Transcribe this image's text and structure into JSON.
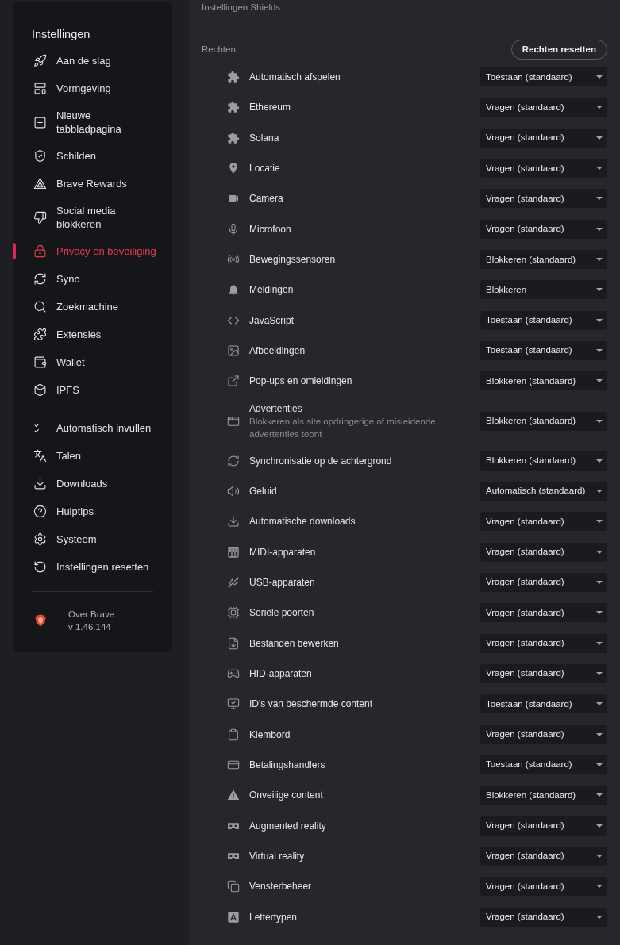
{
  "sidebar": {
    "title": "Instellingen",
    "sections": [
      {
        "items": [
          {
            "label": "Aan de slag",
            "selected": false
          },
          {
            "label": "Vormgeving",
            "selected": false
          },
          {
            "label": "Nieuwe tabbladpagina",
            "selected": false
          },
          {
            "label": "Schilden",
            "selected": false
          },
          {
            "label": "Brave Rewards",
            "selected": false
          },
          {
            "label": "Social media blokkeren",
            "selected": false
          },
          {
            "label": "Privacy en beveiliging",
            "selected": true
          },
          {
            "label": "Sync",
            "selected": false
          },
          {
            "label": "Zoekmachine",
            "selected": false
          },
          {
            "label": "Extensies",
            "selected": false
          },
          {
            "label": "Wallet",
            "selected": false
          },
          {
            "label": "IPFS",
            "selected": false
          }
        ]
      },
      {
        "items": [
          {
            "label": "Automatisch invullen",
            "selected": false
          },
          {
            "label": "Talen",
            "selected": false
          },
          {
            "label": "Downloads",
            "selected": false
          },
          {
            "label": "Hulptips",
            "selected": false
          },
          {
            "label": "Systeem",
            "selected": false
          },
          {
            "label": "Instellingen resetten",
            "selected": false
          }
        ]
      }
    ],
    "about": {
      "title": "Over Brave",
      "version": "v 1.46.144"
    }
  },
  "content": {
    "section_title": "Instellingen Shields",
    "permissions": {
      "title": "Rechten",
      "reset_button": "Rechten resetten",
      "rows": [
        {
          "label": "Automatisch afspelen",
          "value": "Toestaan (standaard)"
        },
        {
          "label": "Ethereum",
          "value": "Vragen (standaard)"
        },
        {
          "label": "Solana",
          "value": "Vragen (standaard)"
        },
        {
          "label": "Locatie",
          "value": "Vragen (standaard)"
        },
        {
          "label": "Camera",
          "value": "Vragen (standaard)"
        },
        {
          "label": "Microfoon",
          "value": "Vragen (standaard)"
        },
        {
          "label": "Bewegingssensoren",
          "value": "Blokkeren (standaard)"
        },
        {
          "label": "Meldingen",
          "value": "Blokkeren"
        },
        {
          "label": "JavaScript",
          "value": "Toestaan (standaard)"
        },
        {
          "label": "Afbeeldingen",
          "value": "Toestaan (standaard)"
        },
        {
          "label": "Pop-ups en omleidingen",
          "value": "Blokkeren (standaard)"
        },
        {
          "label": "Advertenties",
          "description": "Blokkeren als site opdringerige of misleidende advertenties toont",
          "value": "Blokkeren (standaard)"
        },
        {
          "label": "Synchronisatie op de achtergrond",
          "value": "Blokkeren (standaard)"
        },
        {
          "label": "Geluid",
          "value": "Automatisch (standaard)"
        },
        {
          "label": "Automatische downloads",
          "value": "Vragen (standaard)"
        },
        {
          "label": "MIDI-apparaten",
          "value": "Vragen (standaard)"
        },
        {
          "label": "USB-apparaten",
          "value": "Vragen (standaard)"
        },
        {
          "label": "Seriële poorten",
          "value": "Vragen (standaard)"
        },
        {
          "label": "Bestanden bewerken",
          "value": "Vragen (standaard)"
        },
        {
          "label": "HID-apparaten",
          "value": "Vragen (standaard)"
        },
        {
          "label": "ID's van beschermde content",
          "value": "Toestaan (standaard)"
        },
        {
          "label": "Klembord",
          "value": "Vragen (standaard)"
        },
        {
          "label": "Betalingshandlers",
          "value": "Toestaan (standaard)"
        },
        {
          "label": "Onveilige content",
          "value": "Blokkeren (standaard)"
        },
        {
          "label": "Augmented reality",
          "value": "Vragen (standaard)"
        },
        {
          "label": "Virtual reality",
          "value": "Vragen (standaard)"
        },
        {
          "label": "Vensterbeheer",
          "value": "Vragen (standaard)"
        },
        {
          "label": "Lettertypen",
          "value": "Vragen (standaard)"
        }
      ]
    }
  }
}
